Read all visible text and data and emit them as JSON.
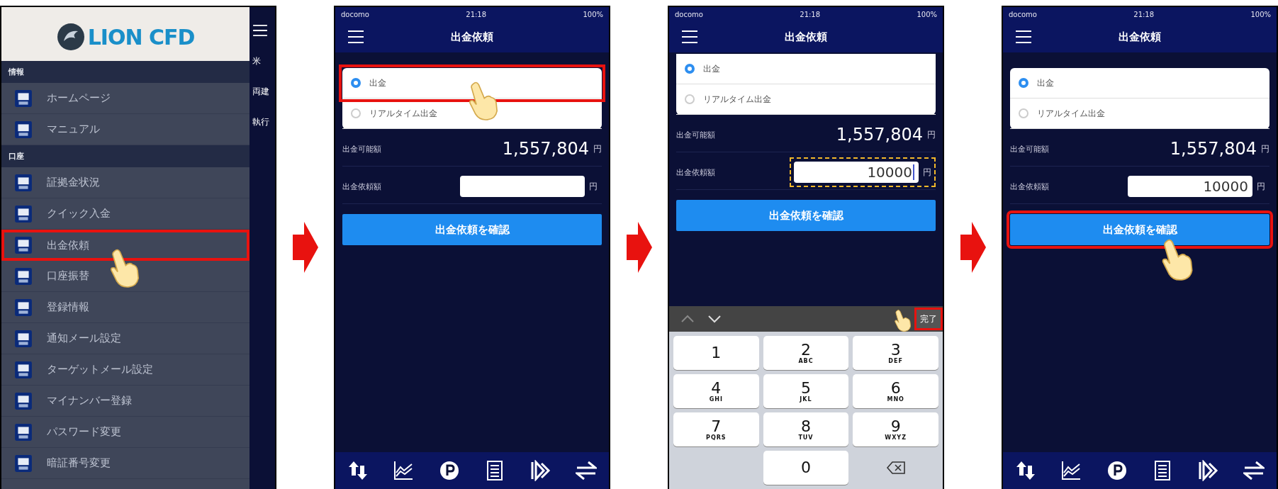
{
  "steps": [
    {
      "kind": "menu",
      "logo": "LION CFD",
      "sections": [
        {
          "title": "情報",
          "items": [
            {
              "label": "ホームページ",
              "highlighted": false
            },
            {
              "label": "マニュアル",
              "highlighted": false
            }
          ]
        },
        {
          "title": "口座",
          "items": [
            {
              "label": "証拠金状況",
              "highlighted": false
            },
            {
              "label": "クイック入金",
              "highlighted": false
            },
            {
              "label": "出金依頼",
              "highlighted": true
            },
            {
              "label": "口座振替",
              "highlighted": false
            },
            {
              "label": "登録情報",
              "highlighted": false
            },
            {
              "label": "通知メール設定",
              "highlighted": false
            },
            {
              "label": "ターゲットメール設定",
              "highlighted": false
            },
            {
              "label": "マイナンバー登録",
              "highlighted": false
            },
            {
              "label": "パスワード変更",
              "highlighted": false
            },
            {
              "label": "暗証番号変更",
              "highlighted": false
            }
          ]
        }
      ],
      "peek": [
        "米",
        "両建",
        "執行"
      ]
    },
    {
      "kind": "form",
      "status": {
        "carrier": "docomo",
        "time": "21:18",
        "battery": "100%"
      },
      "title": "出金依頼",
      "options": [
        {
          "label": "出金",
          "selected": true,
          "highlighted": true
        },
        {
          "label": "リアルタイム出金",
          "selected": false,
          "highlighted": false
        }
      ],
      "available_label": "出金可能額",
      "available_value": "1,557,804",
      "currency": "円",
      "request_label": "出金依頼額",
      "request_currency": "円",
      "field_highlighted": false,
      "focused": false,
      "confirm_button": "出金依頼を確認",
      "confirm_highlighted": false
    },
    {
      "kind": "form",
      "status": {
        "carrier": "docomo",
        "time": "21:18",
        "battery": "100%"
      },
      "title": "出金依頼",
      "options": [
        {
          "label": "出金",
          "selected": true,
          "highlighted": false
        },
        {
          "label": "リアルタイム出金",
          "selected": false,
          "highlighted": false
        }
      ],
      "available_label": "出金可能額",
      "available_value": "1,557,804",
      "currency": "円",
      "request_label": "出金依頼額",
      "request_value": "10000",
      "request_currency": "円",
      "field_highlighted": true,
      "focused": true,
      "confirm_button": "出金依頼を確認",
      "confirm_highlighted": false,
      "keyboard": {
        "done": "完了",
        "done_highlighted": true,
        "keys": [
          {
            "kind": "digit",
            "digit": "1"
          },
          {
            "kind": "digit",
            "digit": "2",
            "letters": "ABC"
          },
          {
            "kind": "digit",
            "digit": "3",
            "letters": "DEF"
          },
          {
            "kind": "digit",
            "digit": "4",
            "letters": "GHI"
          },
          {
            "kind": "digit",
            "digit": "5",
            "letters": "JKL"
          },
          {
            "kind": "digit",
            "digit": "6",
            "letters": "MNO"
          },
          {
            "kind": "digit",
            "digit": "7",
            "letters": "PQRS"
          },
          {
            "kind": "digit",
            "digit": "8",
            "letters": "TUV"
          },
          {
            "kind": "digit",
            "digit": "9",
            "letters": "WXYZ"
          },
          {
            "kind": "blank"
          },
          {
            "kind": "digit",
            "digit": "0"
          },
          {
            "kind": "delete"
          }
        ]
      }
    },
    {
      "kind": "form",
      "status": {
        "carrier": "docomo",
        "time": "21:18",
        "battery": "100%"
      },
      "title": "出金依頼",
      "options": [
        {
          "label": "出金",
          "selected": true,
          "highlighted": false
        },
        {
          "label": "リアルタイム出金",
          "selected": false,
          "highlighted": false
        }
      ],
      "available_label": "出金可能額",
      "available_value": "1,557,804",
      "currency": "円",
      "request_label": "出金依頼額",
      "request_value": "10000",
      "request_currency": "円",
      "field_highlighted": false,
      "focused": false,
      "confirm_button": "出金依頼を確認",
      "confirm_highlighted": true
    }
  ]
}
